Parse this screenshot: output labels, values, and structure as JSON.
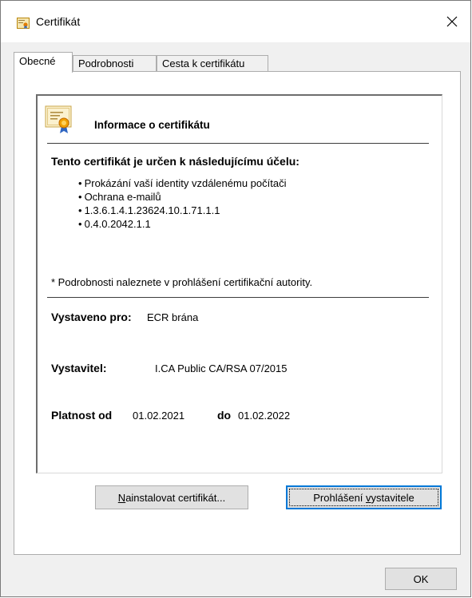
{
  "window": {
    "title": "Certifikát",
    "close_icon": "close-icon"
  },
  "tabs": [
    {
      "label": "Obecné",
      "active": true
    },
    {
      "label": "Podrobnosti",
      "active": false
    },
    {
      "label": "Cesta k certifikátu",
      "active": false
    }
  ],
  "info": {
    "heading": "Informace o certifikátu",
    "purpose_title": "Tento certifikát je určen k následujícímu účelu:",
    "purposes": [
      "Prokázání vaší identity vzdálenému počítači",
      "Ochrana e-mailů",
      "1.3.6.1.4.1.23624.10.1.71.1.1",
      "0.4.0.2042.1.1"
    ],
    "footnote": "* Podrobnosti naleznete v prohlášení certifikační autority.",
    "issued_to_label": "Vystaveno pro:",
    "issued_to_value": "ECR brána",
    "issuer_label": "Vystavitel:",
    "issuer_value": "I.CA Public CA/RSA 07/2015",
    "valid_from_label": "Platnost od",
    "valid_from_value": "01.02.2021",
    "valid_to_label": "do",
    "valid_to_value": "01.02.2022"
  },
  "buttons": {
    "install_pre": "N",
    "install_rest": "ainstalovat certifikát...",
    "statement_pre": "Prohlášení ",
    "statement_ul": "v",
    "statement_rest": "ystavitele",
    "ok": "OK"
  },
  "colors": {
    "window_bg": "#f0f0f0",
    "focus_accent": "#0078d7"
  }
}
